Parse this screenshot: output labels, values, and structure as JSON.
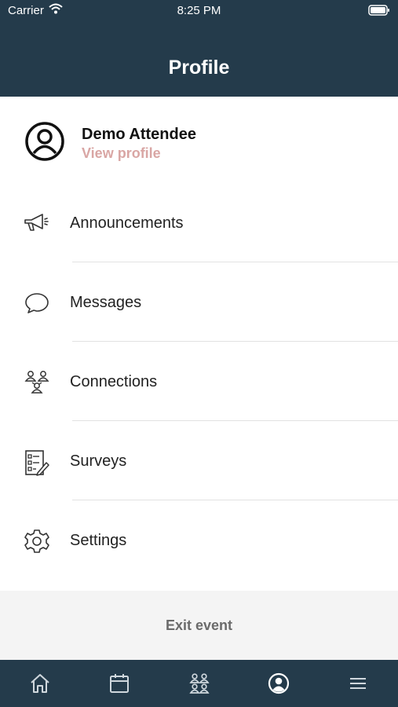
{
  "status_bar": {
    "carrier": "Carrier",
    "time": "8:25 PM"
  },
  "header": {
    "title": "Profile",
    "background_color": "#243b4b"
  },
  "profile": {
    "name": "Demo Attendee",
    "link_label": "View profile",
    "link_color": "#d9a6a4",
    "avatar_icon": "user-circle-icon"
  },
  "menu": {
    "items": [
      {
        "label": "Announcements",
        "icon": "megaphone-icon"
      },
      {
        "label": "Messages",
        "icon": "chat-bubble-icon"
      },
      {
        "label": "Connections",
        "icon": "people-network-icon"
      },
      {
        "label": "Surveys",
        "icon": "survey-checklist-icon"
      },
      {
        "label": "Settings",
        "icon": "gear-icon"
      }
    ]
  },
  "exit": {
    "label": "Exit event"
  },
  "tab_bar": {
    "tabs": [
      {
        "icon": "home-icon",
        "active": false
      },
      {
        "icon": "calendar-icon",
        "active": false
      },
      {
        "icon": "attendees-icon",
        "active": false
      },
      {
        "icon": "profile-icon",
        "active": true
      },
      {
        "icon": "menu-icon",
        "active": false
      }
    ]
  }
}
